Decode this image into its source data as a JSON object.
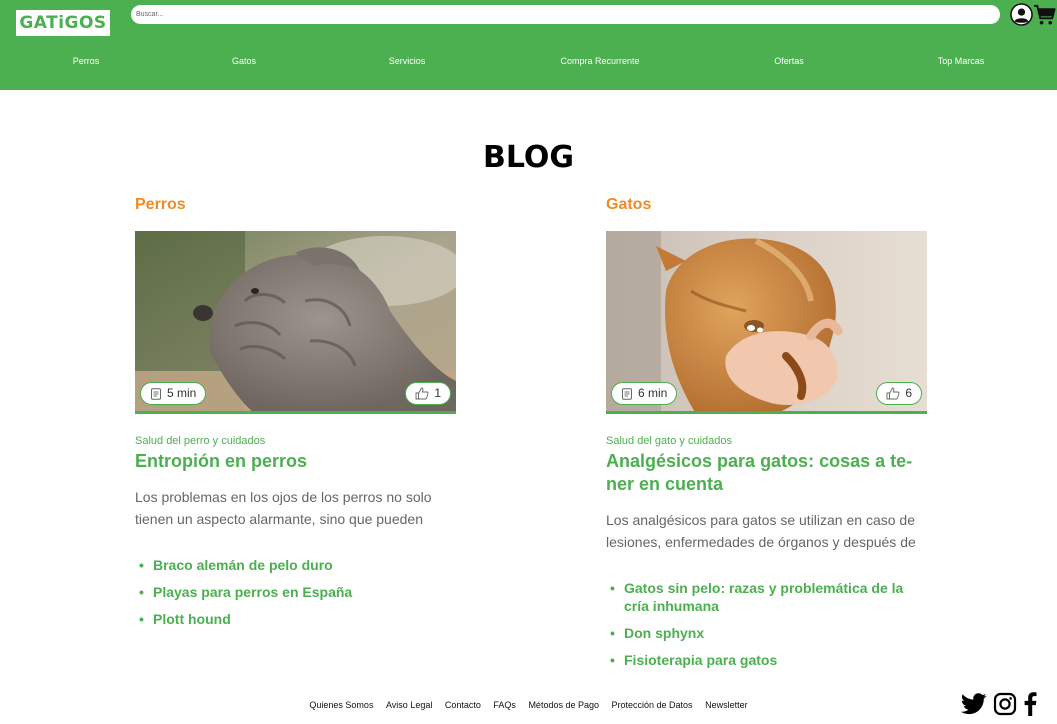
{
  "header": {
    "logo": "GATiGOS",
    "search_placeholder": "Buscar...",
    "nav": [
      "Perros",
      "Gatos",
      "Servicios",
      "Compra Recurrente",
      "Ofertas",
      "Top Marcas"
    ],
    "accent_color": "#4caf50"
  },
  "page_title": "BLOG",
  "columns": [
    {
      "category": "Perros",
      "read_time": "5 min",
      "likes": "1",
      "subcategory": "Salud del perro y cuidados",
      "title": "Entropión en perros",
      "excerpt": "Los problemas en los ojos de los perros no solo tienen un aspecto alarmante, sino que pueden",
      "related": [
        "Braco alemán de pelo duro",
        "Playas para perros en España",
        "Plott hound"
      ],
      "image": "shar-pei-dog-photo"
    },
    {
      "category": "Gatos",
      "read_time": "6 min",
      "likes": "6",
      "subcategory": "Salud del gato y cuidados",
      "title": "Analgésicos para gatos: cosas a te-ner en cuenta",
      "excerpt": "Los analgésicos para gatos se utilizan en caso de lesiones, enfermedades de órganos y después de",
      "related": [
        "Gatos sin pelo: razas y problemática de la cría inhumana",
        "Don sphynx",
        "Fisioterapia para gatos"
      ],
      "image": "cat-eating-from-hand-photo"
    }
  ],
  "footer": {
    "links": [
      "Quienes Somos",
      "Aviso Legal",
      "Contacto",
      "FAQs",
      "Métodos de Pago",
      "Protección de Datos",
      "Newsletter"
    ],
    "social_icons": [
      "twitter-icon",
      "instagram-icon",
      "facebook-icon"
    ]
  }
}
